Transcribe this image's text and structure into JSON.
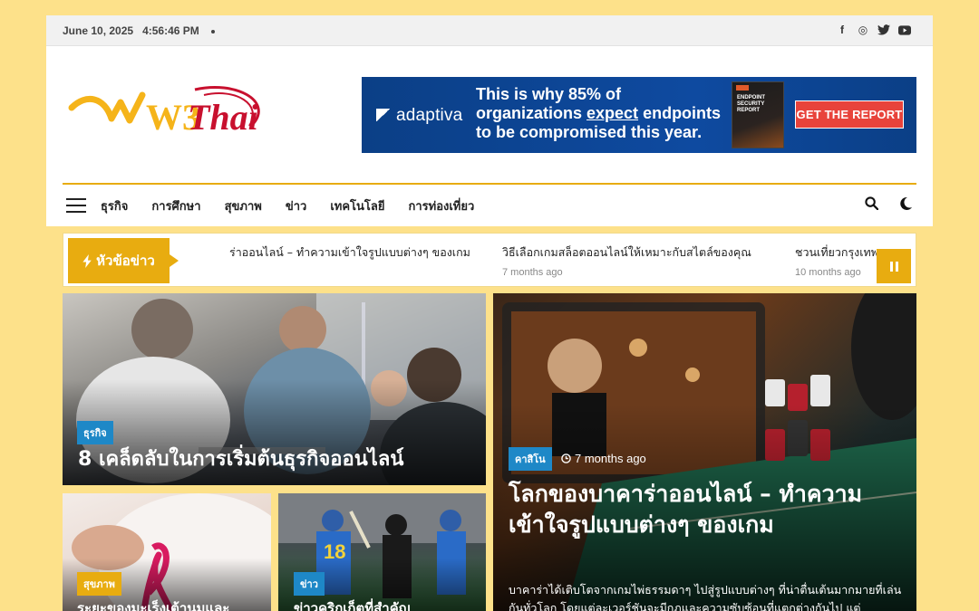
{
  "topbar": {
    "date": "June 10, 2025",
    "time": "4:56:46 PM"
  },
  "social": [
    {
      "icon": "facebook-icon",
      "glyph": "f"
    },
    {
      "icon": "instagram-icon",
      "glyph": "◎"
    },
    {
      "icon": "twitter-icon",
      "glyph": "🐦"
    },
    {
      "icon": "youtube-icon",
      "glyph": "▶"
    }
  ],
  "logo": {
    "text_w3": "W3",
    "text_thai": "Thai"
  },
  "ad": {
    "brand": "adaptiva",
    "headline_1": "This is why 85% of",
    "headline_2a": "organizations ",
    "headline_2b": "expect",
    "headline_2c": " endpoints",
    "headline_3": "to be compromised this year.",
    "book_tag": "2025",
    "book_title": "ENDPOINT SECURITY REPORT",
    "cta": "GET THE REPORT"
  },
  "nav": {
    "items": [
      "ธุรกิจ",
      "การศึกษา",
      "สุขภาพ",
      "ข่าว",
      "เทคโนโลยี",
      "การท่องเที่ยว"
    ]
  },
  "ticker": {
    "label": "หัวข้อข่าว",
    "items": [
      {
        "title": "ร่าออนไลน์ – ทำความเข้าใจรูปแบบต่างๆ ของเกม",
        "time": ""
      },
      {
        "title": "วิธีเลือกเกมสล็อตออนไลน์ให้เหมาะกับสไตล์ของคุณ",
        "time": "7 months ago"
      },
      {
        "title": "ชวนเที่ยวกรุงเทพฯ แจกพิกัด",
        "time": "10 months ago"
      }
    ]
  },
  "cards": {
    "business": {
      "category": "ธุรกิจ",
      "title": "8 เคล็ดลับในการเริ่มต้นธุรกิจออนไลน์"
    },
    "casino": {
      "category": "คาสิโน",
      "time": "7 months ago",
      "title": "โลกของบาคาร่าออนไลน์ – ทำความเข้าใจรูปแบบต่างๆ ของเกม",
      "excerpt": "บาคาร่าได้เติบโตจากเกมไพ่ธรรมดาๆ ไปสู่รูปแบบต่างๆ ที่น่าตื่นเต้นมากมายที่เล่นกันทั่วโลก โดยแต่ละเวอร์ชันจะมีกฎและความซับซ้อนที่แตกต่างกันไป แต่"
    },
    "health": {
      "category": "สุขภาพ",
      "title": "ระยะของมะเร็งเต้านมและ"
    },
    "news": {
      "category": "ข่าว",
      "title": "ข่าวคริกเก็ตที่สำคัญ"
    }
  },
  "colors": {
    "accent": "#e8ac10",
    "cat_blue": "#1e88c7",
    "page_bg": "#fde18a"
  }
}
